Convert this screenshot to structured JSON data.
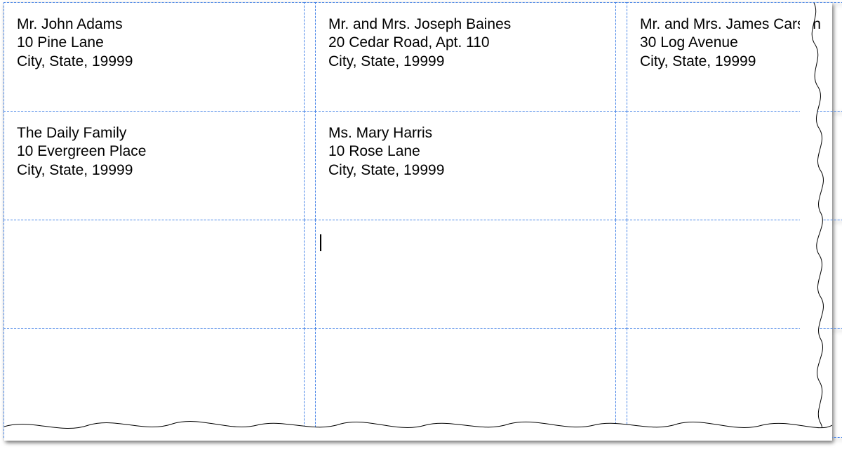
{
  "grid": {
    "columns": 3,
    "gutters": 2
  },
  "labels": [
    [
      {
        "name": "Mr. John Adams",
        "street": "10 Pine Lane",
        "city": "City, State, 19999"
      },
      {
        "name": "Mr. and Mrs. Joseph Baines",
        "street": "20 Cedar Road, Apt. 110",
        "city": "City, State, 19999"
      },
      {
        "name": "Mr. and Mrs. James Carson",
        "street": "30 Log Avenue",
        "city": "City, State, 19999"
      }
    ],
    [
      {
        "name": "The Daily Family",
        "street": "10 Evergreen Place",
        "city": "City, State, 19999"
      },
      {
        "name": "Ms. Mary Harris",
        "street": "10 Rose Lane",
        "city": "City, State, 19999"
      },
      {
        "name": "",
        "street": "",
        "city": ""
      }
    ],
    [
      {
        "name": "",
        "street": "",
        "city": "",
        "cursor": true
      },
      {
        "name": "",
        "street": "",
        "city": ""
      },
      {
        "name": "",
        "street": "",
        "city": ""
      }
    ],
    [
      {
        "name": "",
        "street": "",
        "city": ""
      },
      {
        "name": "",
        "street": "",
        "city": ""
      },
      {
        "name": "",
        "street": "",
        "city": ""
      }
    ]
  ],
  "colors": {
    "gridline": "#4a86e8",
    "text": "#000000"
  }
}
